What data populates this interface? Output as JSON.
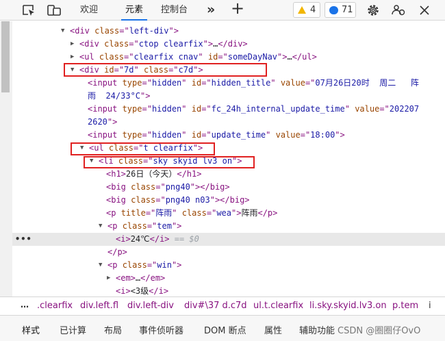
{
  "toolbar": {
    "tabs": [
      "欢迎",
      "元素",
      "控制台"
    ],
    "active_tab": 1,
    "warnings_count": "4",
    "messages_count": "71"
  },
  "tree": {
    "selected_row_suffix": " == $0",
    "rows": [
      [
        [
          "tg",
          "<div "
        ],
        [
          "an",
          "class"
        ],
        [
          "tg",
          "=\""
        ],
        [
          "av",
          "left-div"
        ],
        [
          "tg",
          "\">"
        ]
      ],
      [
        [
          "tg",
          "<div "
        ],
        [
          "an",
          "class"
        ],
        [
          "tg",
          "=\""
        ],
        [
          "av",
          "ctop clearfix"
        ],
        [
          "tg",
          "\">"
        ],
        [
          "tx",
          "…"
        ],
        [
          "tg",
          "</div>"
        ]
      ],
      [
        [
          "tg",
          "<ul "
        ],
        [
          "an",
          "class"
        ],
        [
          "tg",
          "=\""
        ],
        [
          "av",
          "clearfix cnav"
        ],
        [
          "tg",
          "\" "
        ],
        [
          "an",
          "id"
        ],
        [
          "tg",
          "=\""
        ],
        [
          "av",
          "someDayNav"
        ],
        [
          "tg",
          "\">"
        ],
        [
          "tx",
          "…"
        ],
        [
          "tg",
          "</ul>"
        ]
      ],
      [
        [
          "tg",
          "<div "
        ],
        [
          "an",
          "id"
        ],
        [
          "tg",
          "=\""
        ],
        [
          "av",
          "7d"
        ],
        [
          "tg",
          "\" "
        ],
        [
          "an",
          "class"
        ],
        [
          "tg",
          "=\""
        ],
        [
          "av",
          "c7d"
        ],
        [
          "tg",
          "\">"
        ]
      ],
      [
        [
          "tg",
          "<input "
        ],
        [
          "an",
          "type"
        ],
        [
          "tg",
          "=\""
        ],
        [
          "av",
          "hidden"
        ],
        [
          "tg",
          "\" "
        ],
        [
          "an",
          "id"
        ],
        [
          "tg",
          "=\""
        ],
        [
          "av",
          "hidden_title"
        ],
        [
          "tg",
          "\" "
        ],
        [
          "an",
          "value"
        ],
        [
          "tg",
          "=\""
        ],
        [
          "av",
          "07月26日20时  周二   阵"
        ]
      ],
      [
        [
          "av",
          "雨  24/33°C"
        ],
        [
          "tg",
          "\">"
        ]
      ],
      [
        [
          "tg",
          "<input "
        ],
        [
          "an",
          "type"
        ],
        [
          "tg",
          "=\""
        ],
        [
          "av",
          "hidden"
        ],
        [
          "tg",
          "\" "
        ],
        [
          "an",
          "id"
        ],
        [
          "tg",
          "=\""
        ],
        [
          "av",
          "fc_24h_internal_update_time"
        ],
        [
          "tg",
          "\" "
        ],
        [
          "an",
          "value"
        ],
        [
          "tg",
          "=\""
        ],
        [
          "av",
          "202207"
        ]
      ],
      [
        [
          "av",
          "2620"
        ],
        [
          "tg",
          "\">"
        ]
      ],
      [
        [
          "tg",
          "<input "
        ],
        [
          "an",
          "type"
        ],
        [
          "tg",
          "=\""
        ],
        [
          "av",
          "hidden"
        ],
        [
          "tg",
          "\" "
        ],
        [
          "an",
          "id"
        ],
        [
          "tg",
          "=\""
        ],
        [
          "av",
          "update_time"
        ],
        [
          "tg",
          "\" "
        ],
        [
          "an",
          "value"
        ],
        [
          "tg",
          "=\""
        ],
        [
          "av",
          "18:00"
        ],
        [
          "tg",
          "\">"
        ]
      ],
      [
        [
          "tg",
          "<ul "
        ],
        [
          "an",
          "class"
        ],
        [
          "tg",
          "=\""
        ],
        [
          "av",
          "t clearfix"
        ],
        [
          "tg",
          "\">"
        ]
      ],
      [
        [
          "tg",
          "<li "
        ],
        [
          "an",
          "class"
        ],
        [
          "tg",
          "=\""
        ],
        [
          "av",
          "sky skyid lv3 on"
        ],
        [
          "tg",
          "\">"
        ]
      ],
      [
        [
          "tg",
          "<h1>"
        ],
        [
          "tx",
          "26日（今天）"
        ],
        [
          "tg",
          "</h1>"
        ]
      ],
      [
        [
          "tg",
          "<big "
        ],
        [
          "an",
          "class"
        ],
        [
          "tg",
          "=\""
        ],
        [
          "av",
          "png40"
        ],
        [
          "tg",
          "\"></big>"
        ]
      ],
      [
        [
          "tg",
          "<big "
        ],
        [
          "an",
          "class"
        ],
        [
          "tg",
          "=\""
        ],
        [
          "av",
          "png40 n03"
        ],
        [
          "tg",
          "\"></big>"
        ]
      ],
      [
        [
          "tg",
          "<p "
        ],
        [
          "an",
          "title"
        ],
        [
          "tg",
          "=\""
        ],
        [
          "av",
          "阵雨"
        ],
        [
          "tg",
          "\" "
        ],
        [
          "an",
          "class"
        ],
        [
          "tg",
          "=\""
        ],
        [
          "av",
          "wea"
        ],
        [
          "tg",
          "\">"
        ],
        [
          "tx",
          "阵雨"
        ],
        [
          "tg",
          "</p>"
        ]
      ],
      [
        [
          "tg",
          "<p "
        ],
        [
          "an",
          "class"
        ],
        [
          "tg",
          "=\""
        ],
        [
          "av",
          "tem"
        ],
        [
          "tg",
          "\">"
        ]
      ],
      [
        [
          "tg",
          "<i>"
        ],
        [
          "tx",
          "24℃"
        ],
        [
          "tg",
          "</i>"
        ]
      ],
      [
        [
          "tg",
          "</p>"
        ]
      ],
      [
        [
          "tg",
          "<p "
        ],
        [
          "an",
          "class"
        ],
        [
          "tg",
          "=\""
        ],
        [
          "av",
          "win"
        ],
        [
          "tg",
          "\">"
        ]
      ],
      [
        [
          "tg",
          "<em>"
        ],
        [
          "tx",
          "…"
        ],
        [
          "tg",
          "</em>"
        ]
      ],
      [
        [
          "tg",
          "<i>"
        ],
        [
          "tx",
          "<3级"
        ],
        [
          "tg",
          "</i>"
        ]
      ]
    ]
  },
  "breadcrumb": {
    "items": [
      ".clearfix",
      "div.left.fl",
      "div.left-div",
      "div#\\37 d.c7d",
      "ul.t.clearfix",
      "li.sky.skyid.lv3.on",
      "p.tem",
      "i"
    ]
  },
  "bottom_tabs": {
    "items": [
      "样式",
      "已计算",
      "布局",
      "事件侦听器",
      "DOM 断点",
      "属性",
      "辅助功能"
    ],
    "active": 0
  },
  "watermark": "CSDN @圈圈仔OvO"
}
